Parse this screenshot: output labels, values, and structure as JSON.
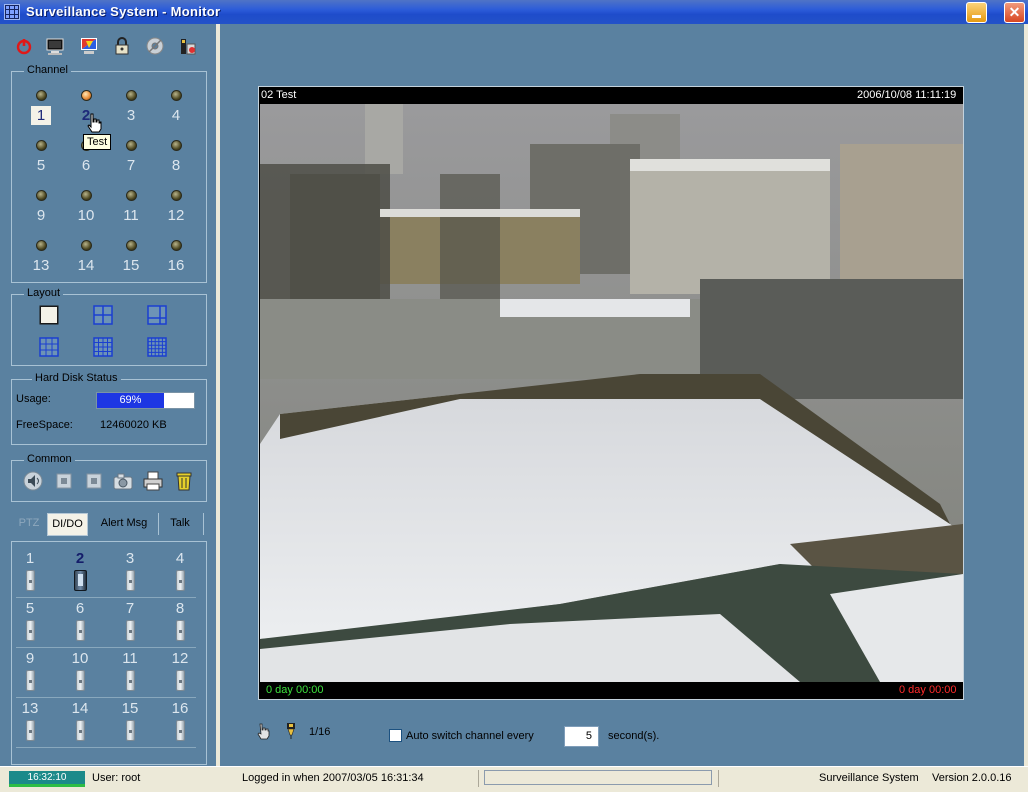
{
  "window": {
    "title": "Surveillance System - Monitor",
    "close_glyph": "✕"
  },
  "toolbar": {
    "icons": [
      "power-icon",
      "monitor-icon",
      "color-icon",
      "lock-icon",
      "disc-icon",
      "tools-icon"
    ]
  },
  "channel_group": {
    "title": "Channel",
    "channels": [
      "1",
      "2",
      "3",
      "4",
      "5",
      "6",
      "7",
      "8",
      "9",
      "10",
      "11",
      "12",
      "13",
      "14",
      "15",
      "16"
    ],
    "selected": "1",
    "active_led": "2",
    "tooltip": "Test"
  },
  "layout_group": {
    "title": "Layout",
    "options": [
      "1x1",
      "2x2",
      "1+3",
      "3x3",
      "4x4",
      "5x5"
    ]
  },
  "hdd_group": {
    "title": "Hard Disk Status",
    "usage_label": "Usage:",
    "usage_value": "69%",
    "usage_fraction": 0.69,
    "freespace_label": "FreeSpace:",
    "freespace_value": "12460020 KB"
  },
  "common_group": {
    "title": "Common",
    "icons": [
      "speaker-icon",
      "stop-icon",
      "record-icon",
      "camera-icon",
      "printer-icon",
      "trash-icon"
    ]
  },
  "tabs": [
    {
      "label": "PTZ",
      "state": "disabled"
    },
    {
      "label": "DI/DO",
      "state": "active"
    },
    {
      "label": "Alert Msg",
      "state": "normal"
    },
    {
      "label": "Talk",
      "state": "normal"
    }
  ],
  "dio": {
    "channels": [
      "1",
      "2",
      "3",
      "4",
      "5",
      "6",
      "7",
      "8",
      "9",
      "10",
      "11",
      "12",
      "13",
      "14",
      "15",
      "16"
    ],
    "active": "2"
  },
  "video": {
    "header_left": "02  Test",
    "header_right": "2006/10/08 11:11:19",
    "footer_left": "0 day  00:00",
    "footer_right": "0 day  00:00"
  },
  "controls": {
    "page_indicator": "1/16",
    "auto_switch_label": "Auto switch channel every",
    "seconds_value": "5",
    "seconds_label": "second(s)."
  },
  "statusbar": {
    "clock": "16:32:10",
    "user": "User: root",
    "logged_in": "Logged in when  2007/03/05 16:31:34",
    "app_name": "Surveillance System",
    "version": "Version 2.0.0.16"
  },
  "colors": {
    "panel_bg": "#5a81a0",
    "usage_fill": "#1d36e3",
    "footer_left_color": "#3ee23e",
    "footer_right_color": "#ff2a2a"
  }
}
